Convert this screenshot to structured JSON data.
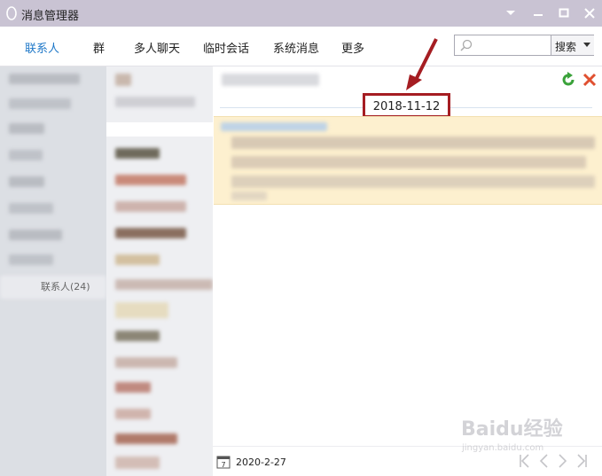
{
  "window": {
    "title": "消息管理器"
  },
  "nav": {
    "tabs": [
      "联系人",
      "群",
      "多人聊天",
      "临时会话",
      "系统消息",
      "更多"
    ],
    "active_tab": "联系人",
    "search": {
      "value": "",
      "button_label": "搜索"
    }
  },
  "contacts_group": {
    "label": "联系人(24)"
  },
  "messages": {
    "date_separator": "2018-11-12"
  },
  "footer": {
    "date": "2020-2-27"
  },
  "watermark": {
    "brand": "Baidu经验",
    "url": "jingyan.baidu.com"
  },
  "colors": {
    "accent": "#1f78c8",
    "annotation": "#a51d22",
    "highlight": "#fdf0cf"
  }
}
